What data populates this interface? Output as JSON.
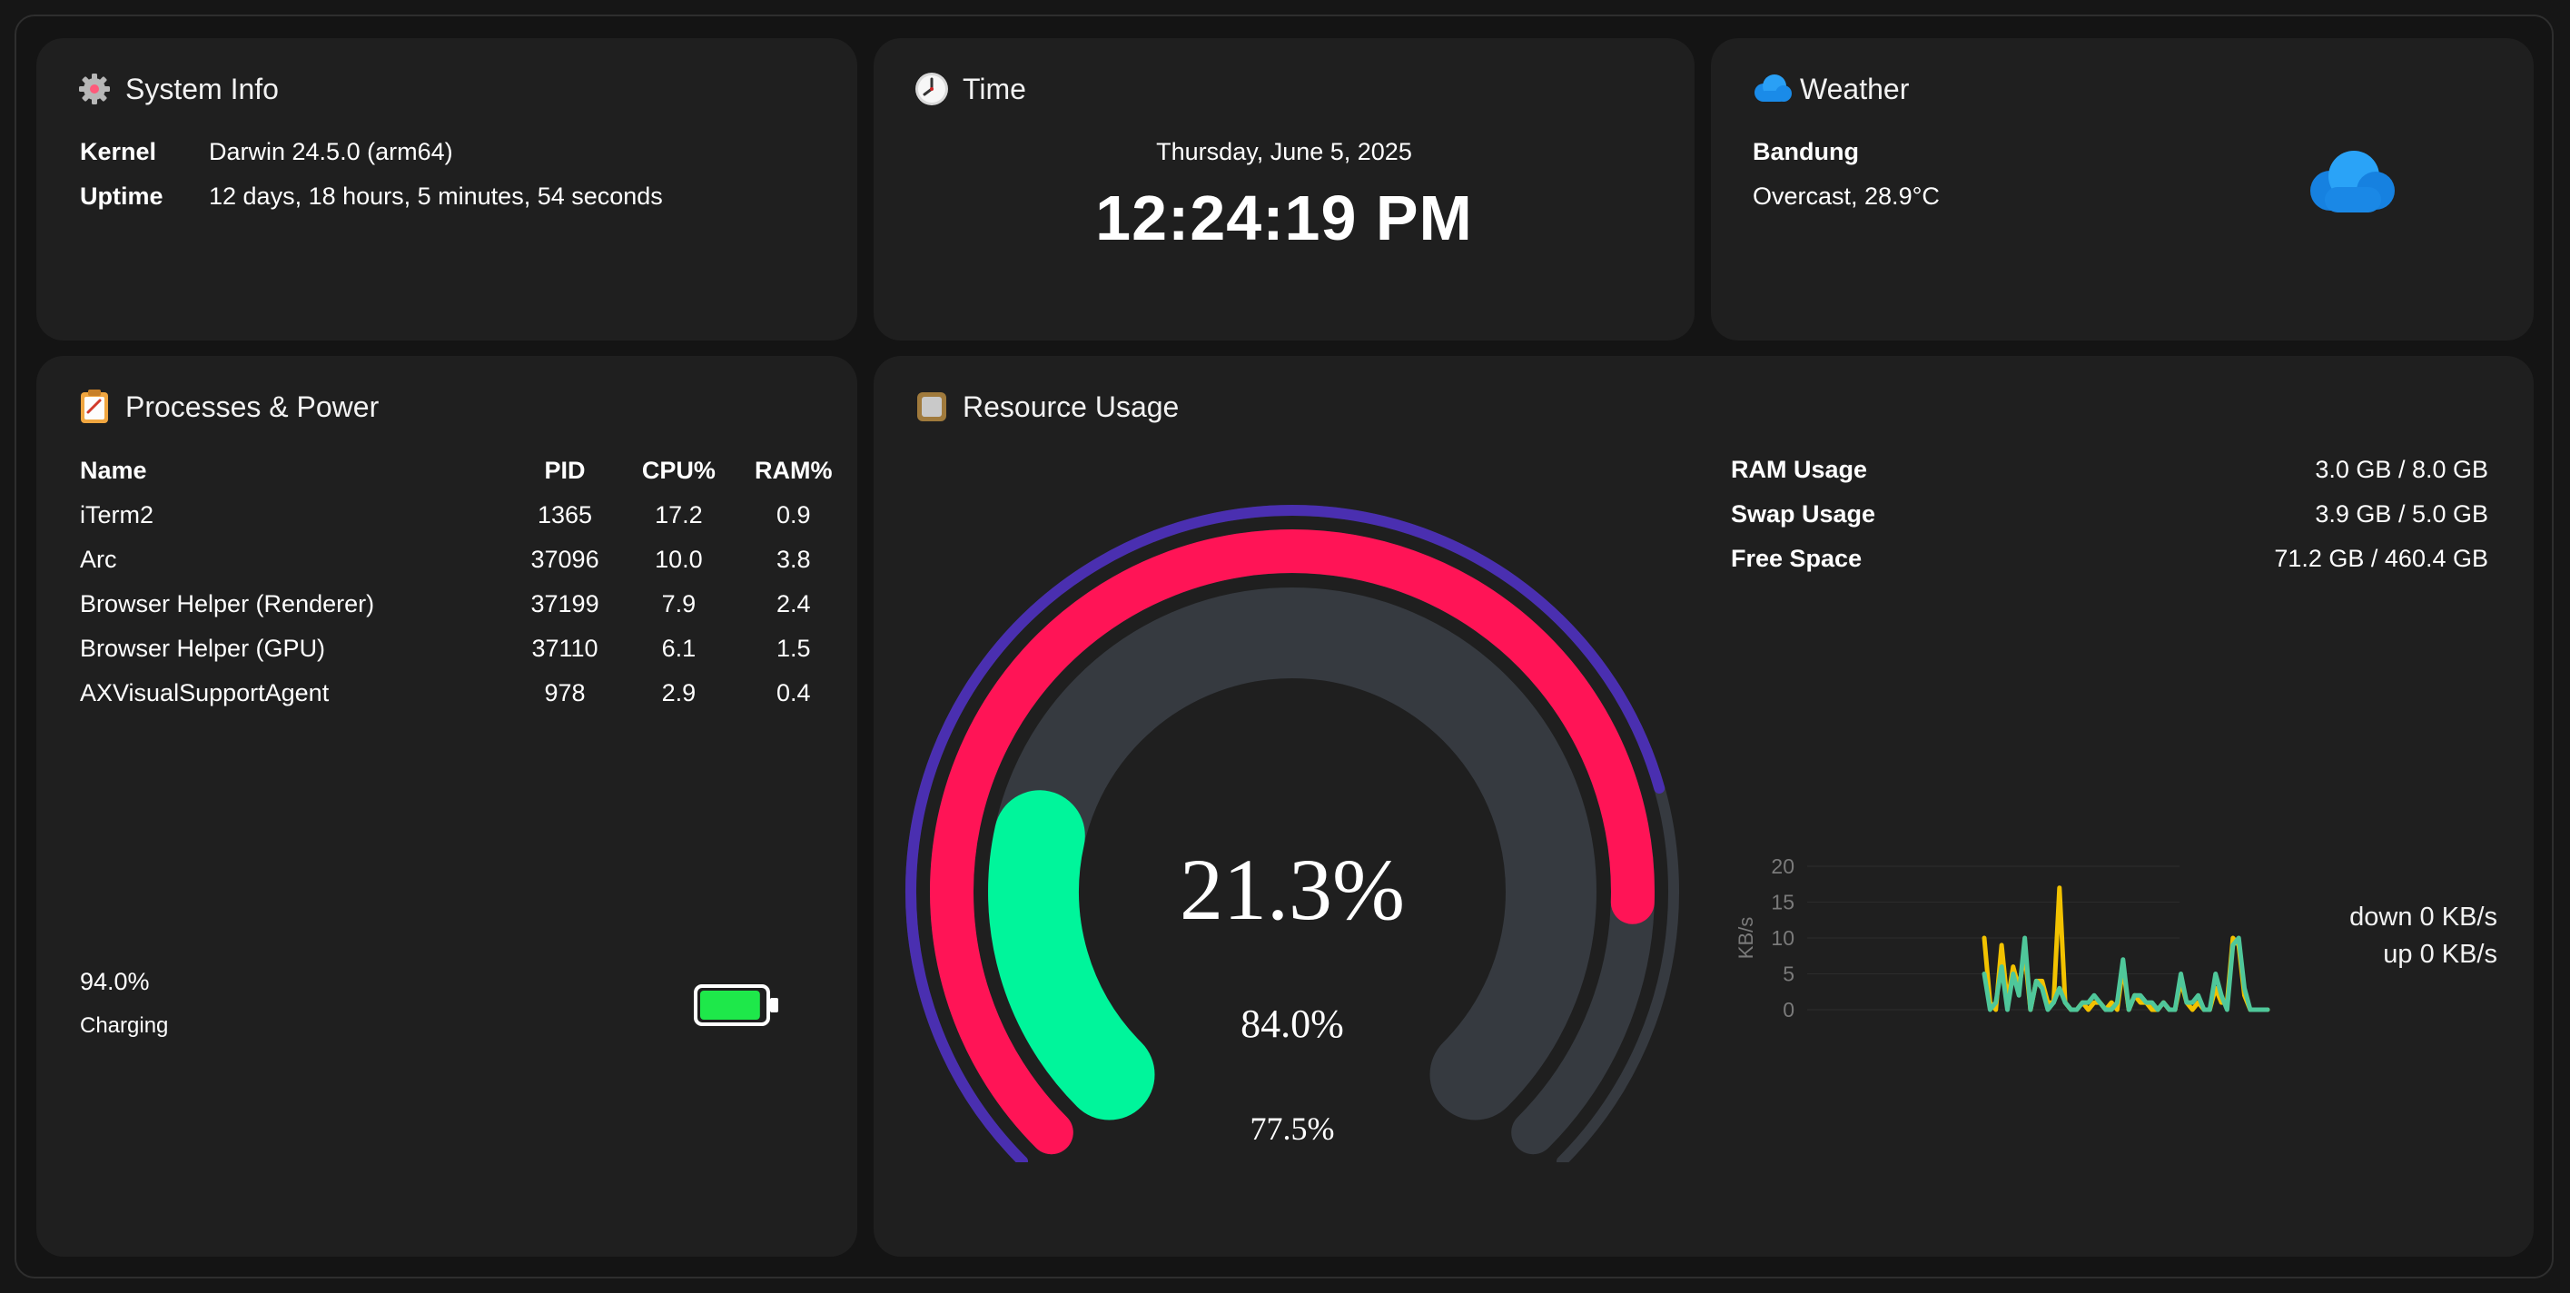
{
  "system_info": {
    "title": "System Info",
    "icon": "gear-icon",
    "kernel_label": "Kernel",
    "kernel_value": "Darwin 24.5.0 (arm64)",
    "uptime_label": "Uptime",
    "uptime_value": "12 days, 18 hours, 5 minutes, 54 seconds"
  },
  "time": {
    "title": "Time",
    "icon": "clock-icon",
    "date": "Thursday, June 5, 2025",
    "clock": "12:24:19 PM"
  },
  "weather": {
    "title": "Weather",
    "icon": "cloud-icon",
    "city": "Bandung",
    "condition": "Overcast, 28.9°C"
  },
  "processes": {
    "title": "Processes & Power",
    "icon": "clipboard-icon",
    "columns": [
      "Name",
      "PID",
      "CPU%",
      "RAM%"
    ],
    "rows": [
      {
        "name": "iTerm2",
        "pid": "1365",
        "cpu": "17.2",
        "ram": "0.9"
      },
      {
        "name": "Arc",
        "pid": "37096",
        "cpu": "10.0",
        "ram": "3.8"
      },
      {
        "name": "Browser Helper (Renderer)",
        "pid": "37199",
        "cpu": "7.9",
        "ram": "2.4"
      },
      {
        "name": "Browser Helper (GPU)",
        "pid": "37110",
        "cpu": "6.1",
        "ram": "1.5"
      },
      {
        "name": "AXVisualSupportAgent",
        "pid": "978",
        "cpu": "2.9",
        "ram": "0.4"
      }
    ],
    "battery_percent": "94.0%",
    "battery_level": 0.94,
    "battery_status": "Charging",
    "battery_color": "#1ee84a"
  },
  "resources": {
    "title": "Resource Usage",
    "icon": "cpu-chip-icon",
    "gauge_inner": {
      "value": 21.3,
      "label": "21.3%",
      "color": "#00f59b"
    },
    "gauge_middle": {
      "value": 84.0,
      "label": "84.0%",
      "color": "#ff1456"
    },
    "gauge_outer": {
      "value": 77.5,
      "label": "77.5%",
      "color": "#4a2fb0"
    },
    "stats": [
      {
        "label": "RAM Usage",
        "value": "3.0 GB / 8.0 GB"
      },
      {
        "label": "Swap Usage",
        "value": "3.9 GB / 5.0 GB"
      },
      {
        "label": "Free Space",
        "value": "71.2 GB / 460.4 GB"
      }
    ],
    "net_down": "down 0 KB/s",
    "net_up": "up 0 KB/s"
  },
  "chart_data": {
    "type": "line",
    "ylabel": "KB/s",
    "ylim": [
      0,
      20
    ],
    "yticks": [
      "20",
      "15",
      "10",
      "5",
      "0"
    ],
    "grid": true,
    "legend": "none",
    "x": [
      1,
      2,
      3,
      4,
      5,
      6,
      7,
      8,
      9,
      10,
      11,
      12,
      13,
      14,
      15,
      16,
      17,
      18,
      19,
      20,
      21,
      22,
      23,
      24,
      25,
      26,
      27,
      28,
      29,
      30,
      31,
      32,
      33,
      34,
      35,
      36,
      37,
      38,
      39,
      40,
      41,
      42,
      43,
      44,
      45,
      46,
      47,
      48,
      49,
      50
    ],
    "series": [
      {
        "color": "#f2c200",
        "values": [
          10,
          1,
          0,
          9,
          1,
          6,
          3,
          8,
          0,
          4,
          4,
          1,
          1,
          17,
          1,
          0,
          0,
          1,
          0,
          1,
          1,
          0,
          1,
          0,
          6,
          0,
          2,
          1,
          1,
          0,
          0,
          1,
          0,
          0,
          4,
          1,
          0,
          1,
          0,
          0,
          3,
          1,
          1,
          10,
          9,
          2,
          0,
          0,
          0,
          0
        ]
      },
      {
        "color": "#4fc79a",
        "values": [
          5,
          0,
          1,
          6,
          0,
          5,
          2,
          10,
          0,
          4,
          3,
          0,
          1,
          3,
          1,
          0,
          0,
          1,
          1,
          2,
          1,
          0,
          0,
          1,
          7,
          0,
          2,
          2,
          1,
          1,
          0,
          1,
          0,
          0,
          5,
          1,
          1,
          2,
          0,
          0,
          5,
          2,
          0,
          9,
          10,
          3,
          0,
          0,
          0,
          0
        ]
      }
    ]
  }
}
